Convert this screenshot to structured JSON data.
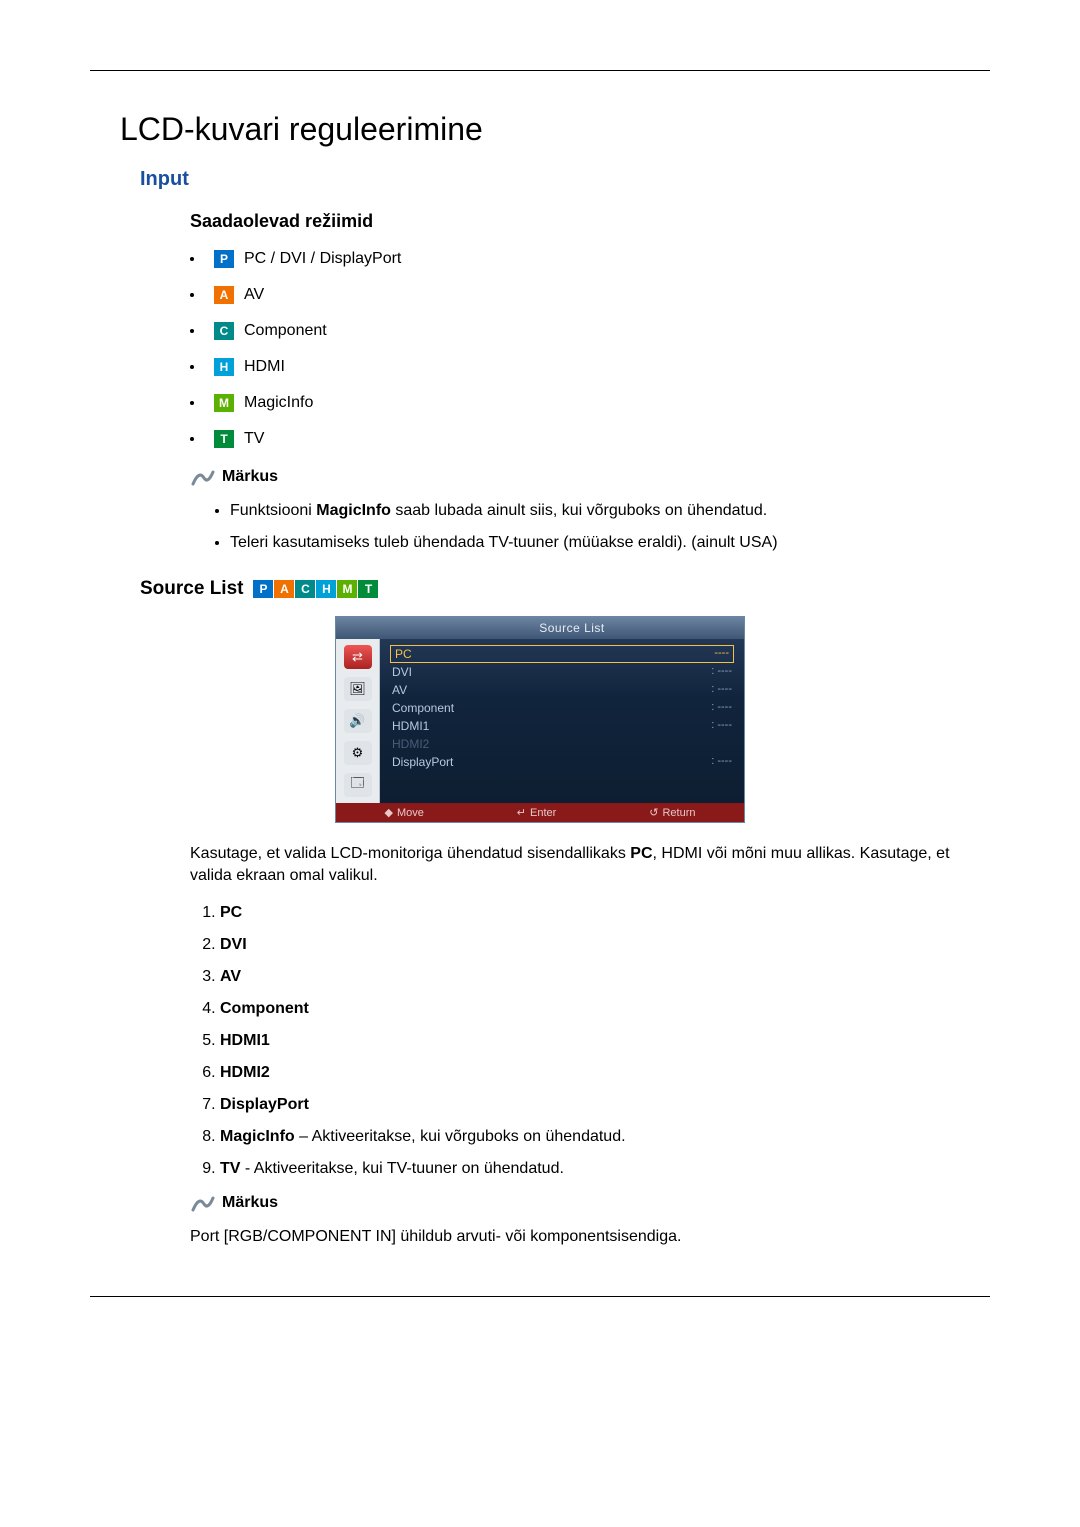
{
  "title": "LCD-kuvari reguleerimine",
  "input_heading": "Input",
  "available_modes_heading": "Saadaolevad režiimid",
  "modes": {
    "p": "PC / DVI / DisplayPort",
    "a": "AV",
    "c": "Component",
    "h": "HDMI",
    "m": "MagicInfo",
    "t": "TV"
  },
  "mode_letters": {
    "p": "P",
    "a": "A",
    "c": "C",
    "h": "H",
    "m": "M",
    "t": "T"
  },
  "note_label": "Märkus",
  "notes": {
    "n1_a": "Funktsiooni ",
    "n1_b": "MagicInfo",
    "n1_c": " saab lubada ainult siis, kui võrguboks on ühendatud.",
    "n2": "Teleri kasutamiseks tuleb ühendada TV-tuuner (müüakse eraldi). (ainult USA)"
  },
  "source_list_heading": "Source List",
  "osd": {
    "title": "Source List",
    "rows": {
      "r1": "PC",
      "r1v": "----",
      "r2": "DVI",
      "r2v": ": ----",
      "r3": "AV",
      "r3v": ": ----",
      "r4": "Component",
      "r4v": ": ----",
      "r5": "HDMI1",
      "r5v": ": ----",
      "r6": "HDMI2",
      "r6v": "",
      "r7": "DisplayPort",
      "r7v": ": ----"
    },
    "footer": {
      "move": "Move",
      "enter": "Enter",
      "ret": "Return"
    }
  },
  "para1_a": "Kasutage, et valida LCD-monitoriga ühendatud sisendallikaks ",
  "para1_b": "PC",
  "para1_c": ", HDMI või mõni muu allikas. Kasutage, et valida ekraan omal valikul.",
  "list": {
    "i1": "PC",
    "i2": "DVI",
    "i3": "AV",
    "i4": "Component",
    "i5": "HDMI1",
    "i6": "HDMI2",
    "i7": "DisplayPort",
    "i8a": "MagicInfo",
    "i8b": " – Aktiveeritakse, kui võrguboks on ühendatud.",
    "i9a": "TV",
    "i9b": " - Aktiveeritakse, kui TV-tuuner on ühendatud."
  },
  "final": "Port [RGB/COMPONENT IN] ühildub arvuti- või komponentsisendiga."
}
